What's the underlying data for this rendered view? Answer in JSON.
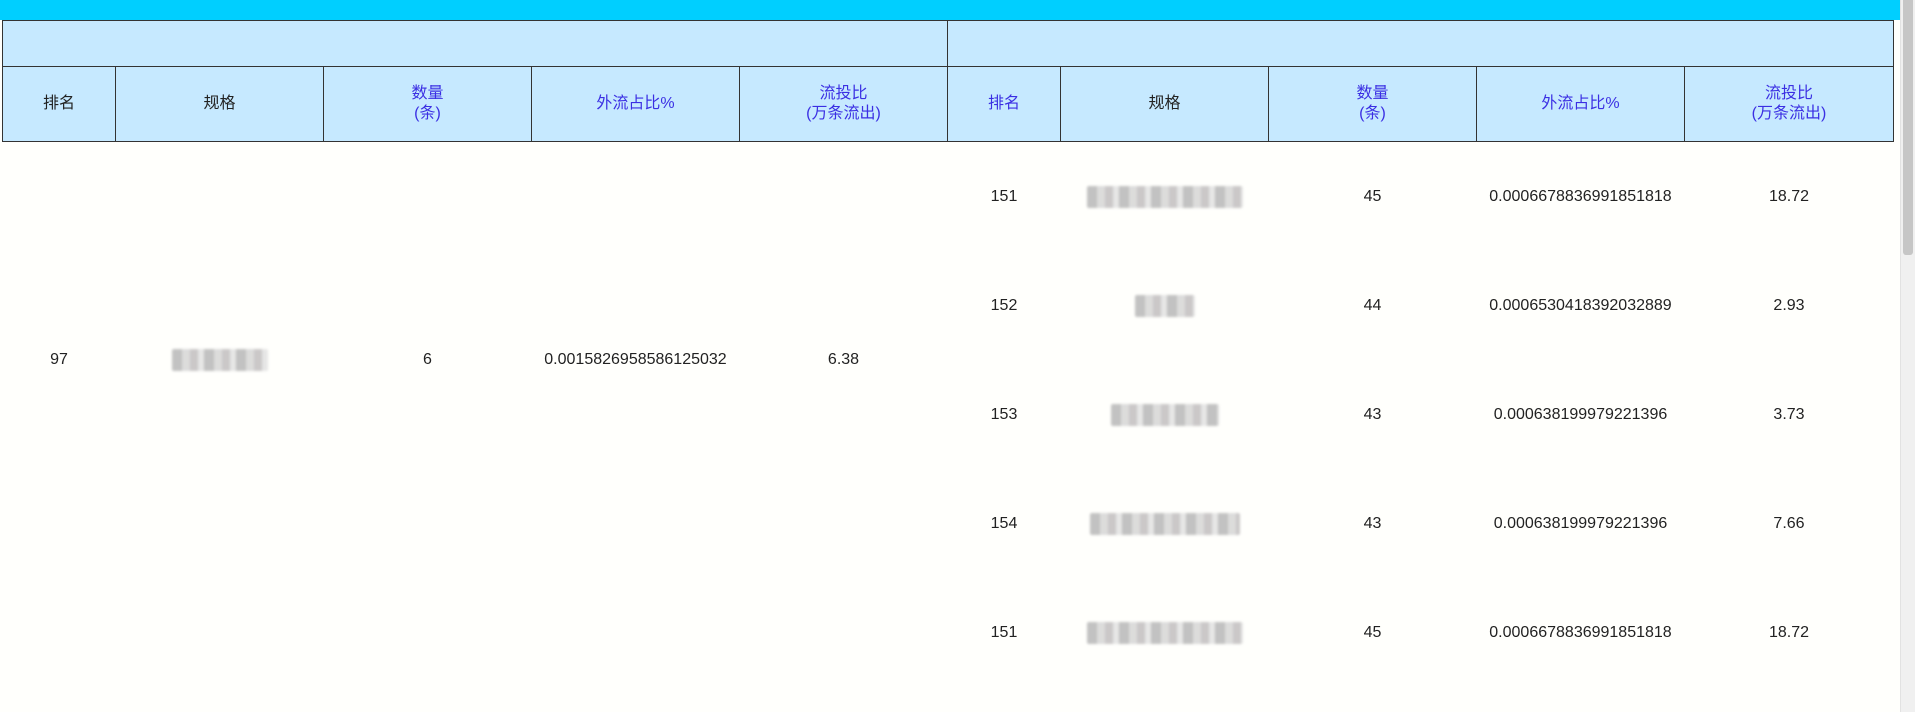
{
  "colors": {
    "top_bar": "#00cfff",
    "header_bg": "#c6e9ff",
    "header_blue_text": "#3b2fe3",
    "border": "#333333",
    "body_bg": "#fffffc"
  },
  "headers": {
    "left": {
      "rank": "排名",
      "spec": "规格",
      "count": "数量\n(条)",
      "outflow_ratio": "外流占比%",
      "flow_invest": "流投比\n(万条流出)"
    },
    "right": {
      "rank": "排名",
      "spec": "规格",
      "count": "数量\n(条)",
      "outflow_ratio": "外流占比%",
      "flow_invest": "流投比\n(万条流出)"
    }
  },
  "left_rows": [
    {
      "rank": "97",
      "spec_icon": "redacted-spec",
      "count": "6",
      "outflow_ratio": "0.0015826958586125032",
      "flow_invest": "6.38"
    }
  ],
  "right_rows": [
    {
      "rank": "151",
      "spec_icon": "redacted-spec",
      "count": "45",
      "outflow_ratio": "0.0006678836991851818",
      "flow_invest": "18.72"
    },
    {
      "rank": "152",
      "spec_icon": "redacted-spec",
      "count": "44",
      "outflow_ratio": "0.0006530418392032889",
      "flow_invest": "2.93"
    },
    {
      "rank": "153",
      "spec_icon": "redacted-spec",
      "count": "43",
      "outflow_ratio": "0.000638199979221396",
      "flow_invest": "3.73"
    },
    {
      "rank": "154",
      "spec_icon": "redacted-spec",
      "count": "43",
      "outflow_ratio": "0.000638199979221396",
      "flow_invest": "7.66"
    },
    {
      "rank": "151",
      "spec_icon": "redacted-spec",
      "count": "45",
      "outflow_ratio": "0.0006678836991851818",
      "flow_invest": "18.72"
    }
  ]
}
